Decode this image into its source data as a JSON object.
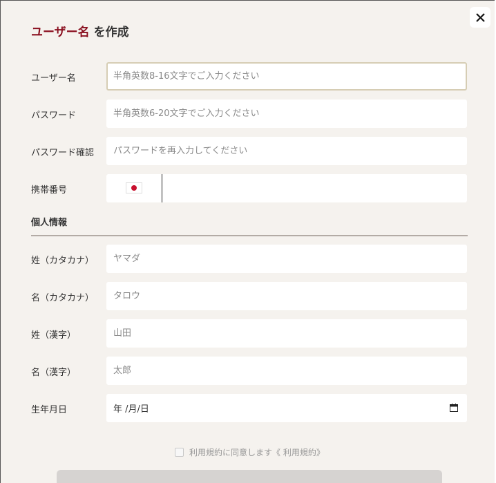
{
  "modal": {
    "title_accent": "ユーザー名",
    "title_rest": " を作成",
    "close_glyph": "×"
  },
  "fields": {
    "username": {
      "label": "ユーザー名",
      "placeholder": "半角英数8-16文字でご入力ください",
      "value": ""
    },
    "password": {
      "label": "パスワード",
      "placeholder": "半角英数6-20文字でご入力ください",
      "value": ""
    },
    "password_confirm": {
      "label": "パスワード確認",
      "placeholder": "パスワードを再入力してください",
      "value": ""
    },
    "phone": {
      "label": "携帯番号",
      "country_flag": "japan-flag-icon",
      "value": ""
    }
  },
  "personal": {
    "heading": "個人情報",
    "last_kana": {
      "label": "姓（カタカナ）",
      "placeholder": "ヤマダ"
    },
    "first_kana": {
      "label": "名（カタカナ）",
      "placeholder": "タロウ"
    },
    "last_kanji": {
      "label": "姓（漢字）",
      "placeholder": "山田"
    },
    "first_kanji": {
      "label": "名（漢字）",
      "placeholder": "太郎"
    },
    "birthday": {
      "label": "生年月日",
      "display": "年 /月/日"
    }
  },
  "terms": {
    "text": "利用規約に同意します《 利用規約》",
    "checked": false
  },
  "colors": {
    "accent": "#8a1020",
    "background": "#f5f2ee",
    "focus_border": "#d6cdb4",
    "flag_red": "#c8102e"
  }
}
